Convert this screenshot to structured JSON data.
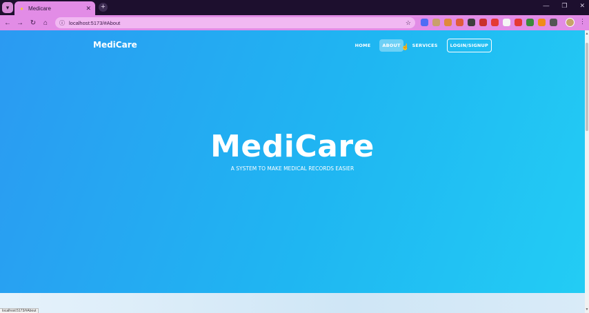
{
  "browser": {
    "tab_title": "Medicare",
    "url": "localhost:5173/#About",
    "status_url": "localhost:5173/#About",
    "extension_colors": [
      "#4f6cf5",
      "#c9a06a",
      "#e08a3c",
      "#e05c3c",
      "#3d3d3d",
      "#c9302c",
      "#e53935",
      "#f4f4f4",
      "#e53935",
      "#3a8a3a",
      "#f08c1a",
      "#555555"
    ]
  },
  "site": {
    "brand": "MediCare",
    "nav": {
      "home": "HOME",
      "about": "ABOUT",
      "services": "SERVICES",
      "login": "LOGIN/SIGNUP"
    },
    "active_nav": "about",
    "hero": {
      "title": "MediCare",
      "subtitle": "A SYSTEM TO MAKE MEDICAL RECORDS EASIER"
    },
    "colors": {
      "gradient_start": "#2b9af2",
      "gradient_end": "#23cdf4",
      "browser_accent": "#e28ce6"
    }
  },
  "icons": {
    "tab_menu": "chevron-down-icon",
    "favicon": "lightbulb-icon",
    "tab_close": "close-icon",
    "new_tab": "plus-icon",
    "back": "back-arrow-icon",
    "forward": "forward-arrow-icon",
    "reload": "reload-icon",
    "home": "home-icon",
    "site_info": "info-icon",
    "bookmark": "star-icon",
    "cursor": "hand-pointer-icon"
  }
}
